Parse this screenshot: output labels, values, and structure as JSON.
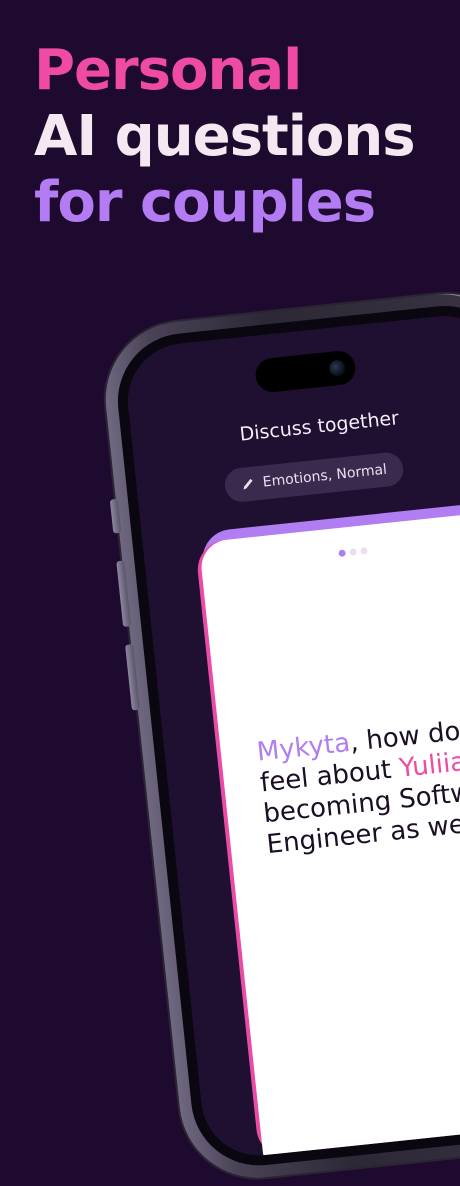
{
  "headline": {
    "line1": "Personal",
    "line2": "AI questions",
    "line3": "for couples"
  },
  "screen": {
    "title": "Discuss together",
    "chip_label": "Emotions, Normal",
    "chip_icon": "pencil-icon",
    "card": {
      "page_dots": 3,
      "active_dot": 1,
      "question_name1": "Mykyta",
      "question_part1": ", how do you feel about ",
      "question_name2": "Yuliia",
      "question_part2": " becoming Software Engineer as well?"
    }
  },
  "colors": {
    "background": "#1e0a2f",
    "pink": "#ef4aa4",
    "lavender": "#f6e8f1",
    "purple": "#b47cf2"
  }
}
